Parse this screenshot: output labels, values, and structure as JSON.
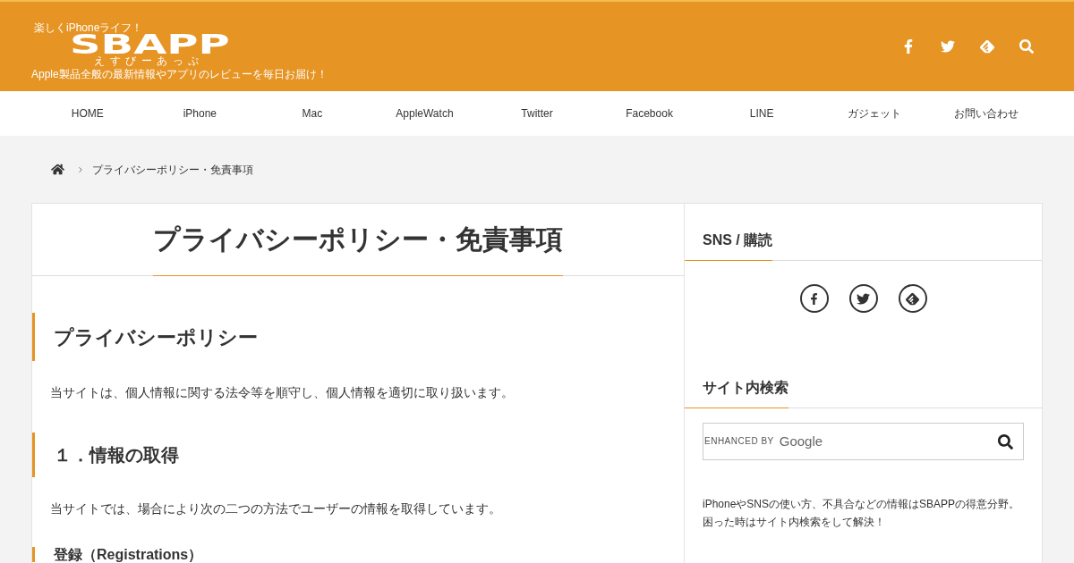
{
  "header": {
    "tagline": "楽しくiPhoneライフ！",
    "logo": "SBAPP",
    "logo_reading": "えすびーあっぷ",
    "description": "Apple製品全般の最新情報やアプリのレビューを毎日お届け！"
  },
  "nav": {
    "items": [
      "HOME",
      "iPhone",
      "Mac",
      "AppleWatch",
      "Twitter",
      "Facebook",
      "LINE",
      "ガジェット",
      "お問い合わせ"
    ]
  },
  "breadcrumb": {
    "current": "プライバシーポリシー・免責事項"
  },
  "article": {
    "title": "プライバシーポリシー・免責事項",
    "blocks": [
      {
        "kind": "h2",
        "text": "プライバシーポリシー"
      },
      {
        "kind": "p",
        "text": "当サイトは、個人情報に関する法令等を順守し、個人情報を適切に取り扱います。"
      },
      {
        "kind": "h3",
        "text": "１．情報の取得"
      },
      {
        "kind": "p",
        "text": "当サイトでは、場合により次の二つの方法でユーザーの情報を取得しています。"
      },
      {
        "kind": "h4",
        "text": "登録（Registrations）"
      }
    ]
  },
  "sidebar": {
    "widgets": [
      {
        "kind": "sns",
        "title": "SNS / 購読"
      },
      {
        "kind": "search",
        "title": "サイト内検索",
        "search": {
          "label": "ENHANCED BY",
          "brand": "Google"
        },
        "lines": [
          "iPhoneやSNSの使い方、不具合などの情報はSBAPPの得意分野。",
          "困った時はサイト内検索をして解決！"
        ]
      }
    ]
  }
}
